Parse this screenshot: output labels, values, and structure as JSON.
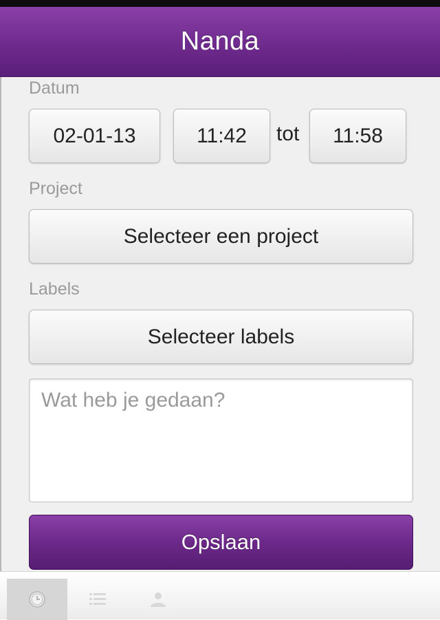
{
  "header": {
    "title": "Nanda"
  },
  "form": {
    "date_label": "Datum",
    "date_value": "02-01-13",
    "start_time": "11:42",
    "to_label": "tot",
    "end_time": "11:58",
    "project_label": "Project",
    "project_button": "Selecteer een project",
    "labels_label": "Labels",
    "labels_button": "Selecteer labels",
    "description_placeholder": "Wat heb je gedaan?",
    "save_button": "Opslaan"
  },
  "tabbar": {
    "tabs": [
      {
        "icon": "clock-icon",
        "active": true
      },
      {
        "icon": "list-icon",
        "active": false
      },
      {
        "icon": "person-icon",
        "active": false
      }
    ]
  },
  "colors": {
    "brand_purple": "#6f2a8e",
    "background": "#f0f0f0",
    "label_gray": "#9a9a9a"
  }
}
